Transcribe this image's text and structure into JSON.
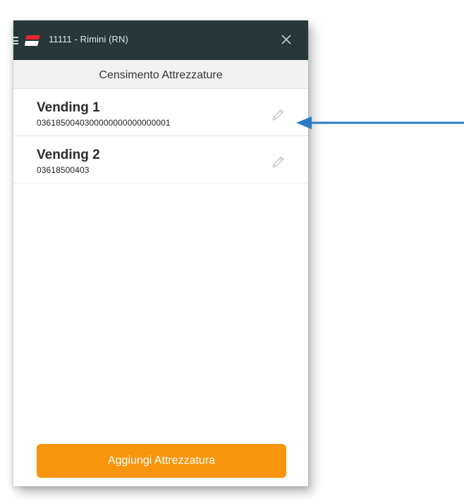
{
  "header": {
    "title": "11111 - Rimini (RN)",
    "menu_icon": "hamburger-menu-icon",
    "logo_icon": "app-logo-icon",
    "close_icon": "close-icon"
  },
  "subheader": {
    "title": "Censimento Attrezzature"
  },
  "equipment_list": [
    {
      "name": "Vending 1",
      "code": "0361850040300000000000000001"
    },
    {
      "name": "Vending 2",
      "code": "03618500403"
    }
  ],
  "actions": {
    "add_label": "Aggiungi Attrezzatura"
  },
  "colors": {
    "topbar": "#27373a",
    "accent_button": "#f7960e",
    "logo_red": "#e5262f",
    "annotation_arrow": "#2b7cc4"
  }
}
